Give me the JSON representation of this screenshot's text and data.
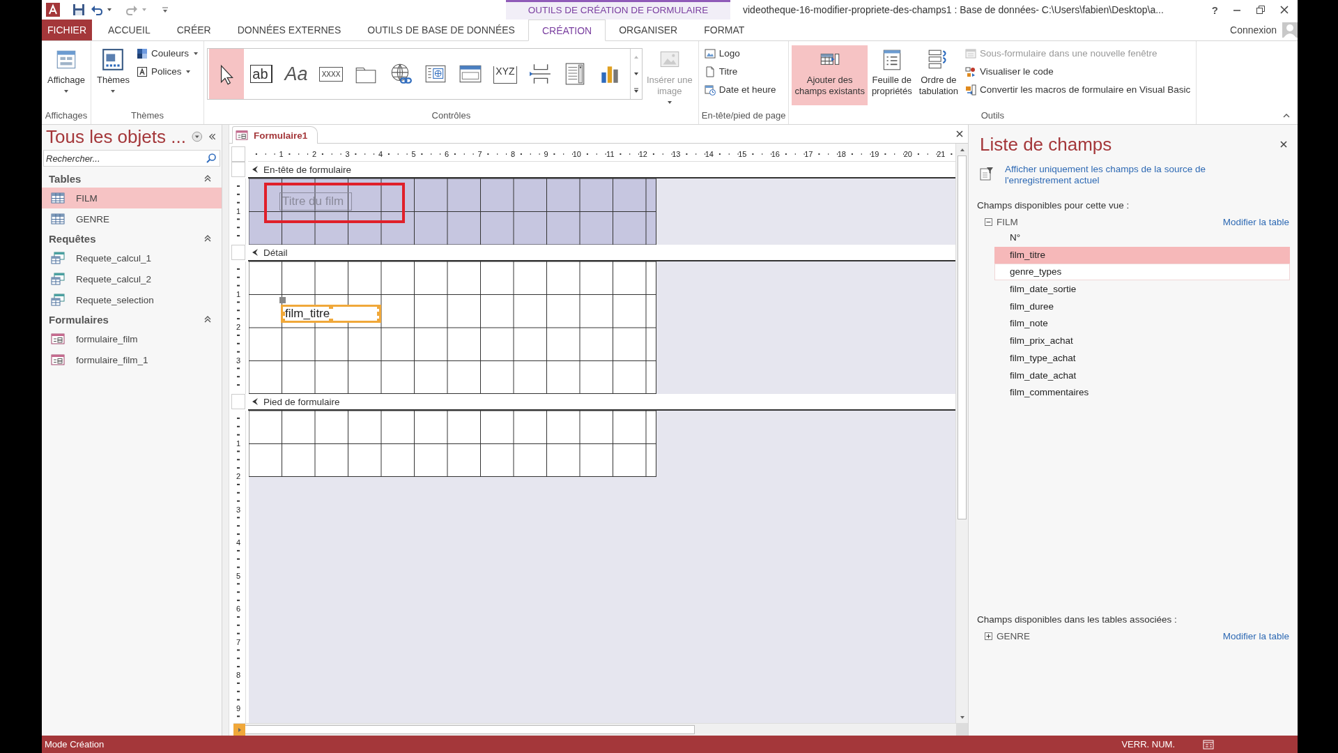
{
  "window": {
    "title": "videotheque-16-modifier-propriete-des-champs1 : Base de données- C:\\Users\\fabien\\Desktop\\a...",
    "help": "?"
  },
  "contextual_tab_group": "OUTILS DE CRÉATION DE FORMULAIRE",
  "tabs": [
    {
      "label": "FICHIER",
      "kind": "file",
      "selected": false
    },
    {
      "label": "ACCUEIL",
      "kind": "tab",
      "selected": false
    },
    {
      "label": "CRÉER",
      "kind": "tab",
      "selected": false
    },
    {
      "label": "DONNÉES EXTERNES",
      "kind": "tab",
      "selected": false
    },
    {
      "label": "OUTILS DE BASE DE DONNÉES",
      "kind": "tab",
      "selected": false
    },
    {
      "label": "CRÉATION",
      "kind": "context",
      "selected": true
    },
    {
      "label": "ORGANISER",
      "kind": "context",
      "selected": false
    },
    {
      "label": "FORMAT",
      "kind": "context",
      "selected": false
    }
  ],
  "account": {
    "label": "Connexion"
  },
  "ribbon": {
    "groups": [
      {
        "label": "Affichages",
        "items": [
          {
            "kind": "large",
            "label": "Affichage",
            "dropdown": true,
            "disabled": false,
            "selected": false
          }
        ]
      },
      {
        "label": "Thèmes",
        "items": [
          {
            "kind": "large",
            "label": "Thèmes",
            "dropdown": true,
            "disabled": false,
            "selected": false
          },
          {
            "kind": "small",
            "label": "Couleurs",
            "dropdown": true,
            "disabled": false,
            "selected": false
          },
          {
            "kind": "small",
            "label": "Polices",
            "dropdown": true,
            "disabled": false,
            "selected": false
          }
        ]
      },
      {
        "label": "Contrôles",
        "gallery": [
          {
            "kind": "pointer",
            "selected": true
          },
          {
            "kind": "textbox",
            "glyph": "ab",
            "selected": false
          },
          {
            "kind": "label",
            "glyph": "Aa",
            "selected": false
          },
          {
            "kind": "button",
            "glyph": "XXXX",
            "selected": false
          },
          {
            "kind": "tabcontrol",
            "selected": false
          },
          {
            "kind": "hyperlink",
            "selected": false
          },
          {
            "kind": "browser",
            "selected": false
          },
          {
            "kind": "navigation",
            "selected": false
          },
          {
            "kind": "group",
            "glyph": "XYZ",
            "selected": false
          },
          {
            "kind": "pagebreak",
            "selected": false
          },
          {
            "kind": "combo",
            "selected": false
          },
          {
            "kind": "chart",
            "selected": false
          }
        ],
        "items": [
          {
            "kind": "large",
            "label": "Insérer une\nimage",
            "dropdown": true,
            "disabled": true,
            "selected": false
          }
        ]
      },
      {
        "label": "En-tête/pied de page",
        "items": [
          {
            "kind": "small",
            "label": "Logo",
            "dropdown": false,
            "disabled": false,
            "selected": false
          },
          {
            "kind": "small",
            "label": "Titre",
            "dropdown": false,
            "disabled": false,
            "selected": false
          },
          {
            "kind": "small",
            "label": "Date et heure",
            "dropdown": false,
            "disabled": false,
            "selected": false
          }
        ]
      },
      {
        "label": "Outils",
        "items": [
          {
            "kind": "large",
            "label": "Ajouter des\nchamps existants",
            "dropdown": false,
            "disabled": false,
            "selected": true
          },
          {
            "kind": "large",
            "label": "Feuille de\npropriétés",
            "dropdown": false,
            "disabled": false,
            "selected": false
          },
          {
            "kind": "large",
            "label": "Ordre de\ntabulation",
            "dropdown": false,
            "disabled": false,
            "selected": false
          },
          {
            "kind": "small",
            "label": "Sous-formulaire dans une nouvelle fenêtre",
            "dropdown": false,
            "disabled": true,
            "selected": false
          },
          {
            "kind": "small",
            "label": "Visualiser le code",
            "dropdown": false,
            "disabled": false,
            "selected": false
          },
          {
            "kind": "small",
            "label": "Convertir les macros de formulaire en Visual Basic",
            "dropdown": false,
            "disabled": false,
            "selected": false
          }
        ]
      }
    ]
  },
  "navigation_pane": {
    "title": "Tous les objets ...",
    "search": {
      "placeholder": "Rechercher..."
    },
    "groups": [
      {
        "label": "Tables",
        "kind": "tables",
        "items": [
          {
            "label": "FILM",
            "selected": true
          },
          {
            "label": "GENRE",
            "selected": false
          }
        ]
      },
      {
        "label": "Requêtes",
        "kind": "queries",
        "items": [
          {
            "label": "Requete_calcul_1",
            "selected": false
          },
          {
            "label": "Requete_calcul_2",
            "selected": false
          },
          {
            "label": "Requete_selection",
            "selected": false
          }
        ]
      },
      {
        "label": "Formulaires",
        "kind": "forms",
        "items": [
          {
            "label": "formulaire_film",
            "selected": false
          },
          {
            "label": "formulaire_film_1",
            "selected": false
          }
        ]
      }
    ]
  },
  "document": {
    "tab": "Formulaire1",
    "ruler": [
      "1",
      "2",
      "3",
      "4",
      "5",
      "6",
      "7",
      "8",
      "9",
      "10",
      "11",
      "12",
      "13",
      "14",
      "15",
      "16",
      "17",
      "18",
      "19",
      "20",
      "21"
    ],
    "sections": [
      {
        "kind": "header",
        "label": "En-tête de formulaire",
        "ruler": [
          "1"
        ],
        "controls": [
          {
            "kind": "label",
            "text": "Titre du film",
            "selected": false,
            "highlighted": true
          }
        ]
      },
      {
        "kind": "detail",
        "label": "Détail",
        "ruler": [
          "1",
          "2",
          "3"
        ],
        "controls": [
          {
            "kind": "textbox",
            "text": "film_titre",
            "selected": true,
            "highlighted": false
          }
        ]
      },
      {
        "kind": "footer",
        "label": "Pied de formulaire",
        "ruler": [
          "1",
          "2",
          "3",
          "4",
          "5",
          "6",
          "7",
          "8",
          "9"
        ]
      }
    ]
  },
  "field_list": {
    "title": "Liste de champs",
    "filter_link": "Afficher uniquement les champs de la source de l'enregistrement actuel",
    "available_label": "Champs disponibles pour cette vue :",
    "tables": [
      {
        "name": "FILM",
        "expanded": true,
        "edit_link": "Modifier la table",
        "fields": [
          {
            "name": "N°",
            "selected": false,
            "hovered": false
          },
          {
            "name": "film_titre",
            "selected": true,
            "hovered": false
          },
          {
            "name": "genre_types",
            "selected": false,
            "hovered": true
          },
          {
            "name": "film_date_sortie",
            "selected": false,
            "hovered": false
          },
          {
            "name": "film_duree",
            "selected": false,
            "hovered": false
          },
          {
            "name": "film_note",
            "selected": false,
            "hovered": false
          },
          {
            "name": "film_prix_achat",
            "selected": false,
            "hovered": false
          },
          {
            "name": "film_type_achat",
            "selected": false,
            "hovered": false
          },
          {
            "name": "film_date_achat",
            "selected": false,
            "hovered": false
          },
          {
            "name": "film_commentaires",
            "selected": false,
            "hovered": false
          }
        ]
      }
    ],
    "related_label": "Champs disponibles dans les tables associées :",
    "related_tables": [
      {
        "name": "GENRE",
        "expanded": false,
        "edit_link": "Modifier la table"
      }
    ]
  },
  "status_bar": {
    "mode": "Mode Création",
    "indicators": [
      "VERR. NUM."
    ]
  }
}
